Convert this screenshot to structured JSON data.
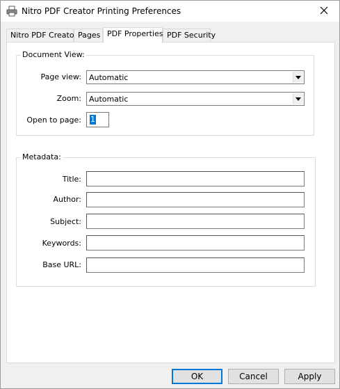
{
  "window": {
    "title": "Nitro PDF Creator Printing Preferences",
    "app_icon": "printer-icon",
    "close_icon": "close-icon"
  },
  "tabs": [
    {
      "label": "Nitro PDF Creator",
      "active": false
    },
    {
      "label": "Pages",
      "active": false
    },
    {
      "label": "PDF Properties",
      "active": true
    },
    {
      "label": "PDF Security",
      "active": false
    }
  ],
  "document_view": {
    "legend": "Document View:",
    "page_view": {
      "label": "Page view:",
      "value": "Automatic"
    },
    "zoom": {
      "label": "Zoom:",
      "value": "Automatic"
    },
    "open_to_page": {
      "label": "Open to page:",
      "value": "1"
    }
  },
  "metadata": {
    "legend": "Metadata:",
    "fields": [
      {
        "label": "Title:",
        "value": ""
      },
      {
        "label": "Author:",
        "value": ""
      },
      {
        "label": "Subject:",
        "value": ""
      },
      {
        "label": "Keywords:",
        "value": ""
      },
      {
        "label": "Base URL:",
        "value": ""
      }
    ]
  },
  "buttons": {
    "ok": "OK",
    "cancel": "Cancel",
    "apply": "Apply"
  },
  "colors": {
    "selection": "#0078d7",
    "default_button_border": "#0078d7"
  }
}
